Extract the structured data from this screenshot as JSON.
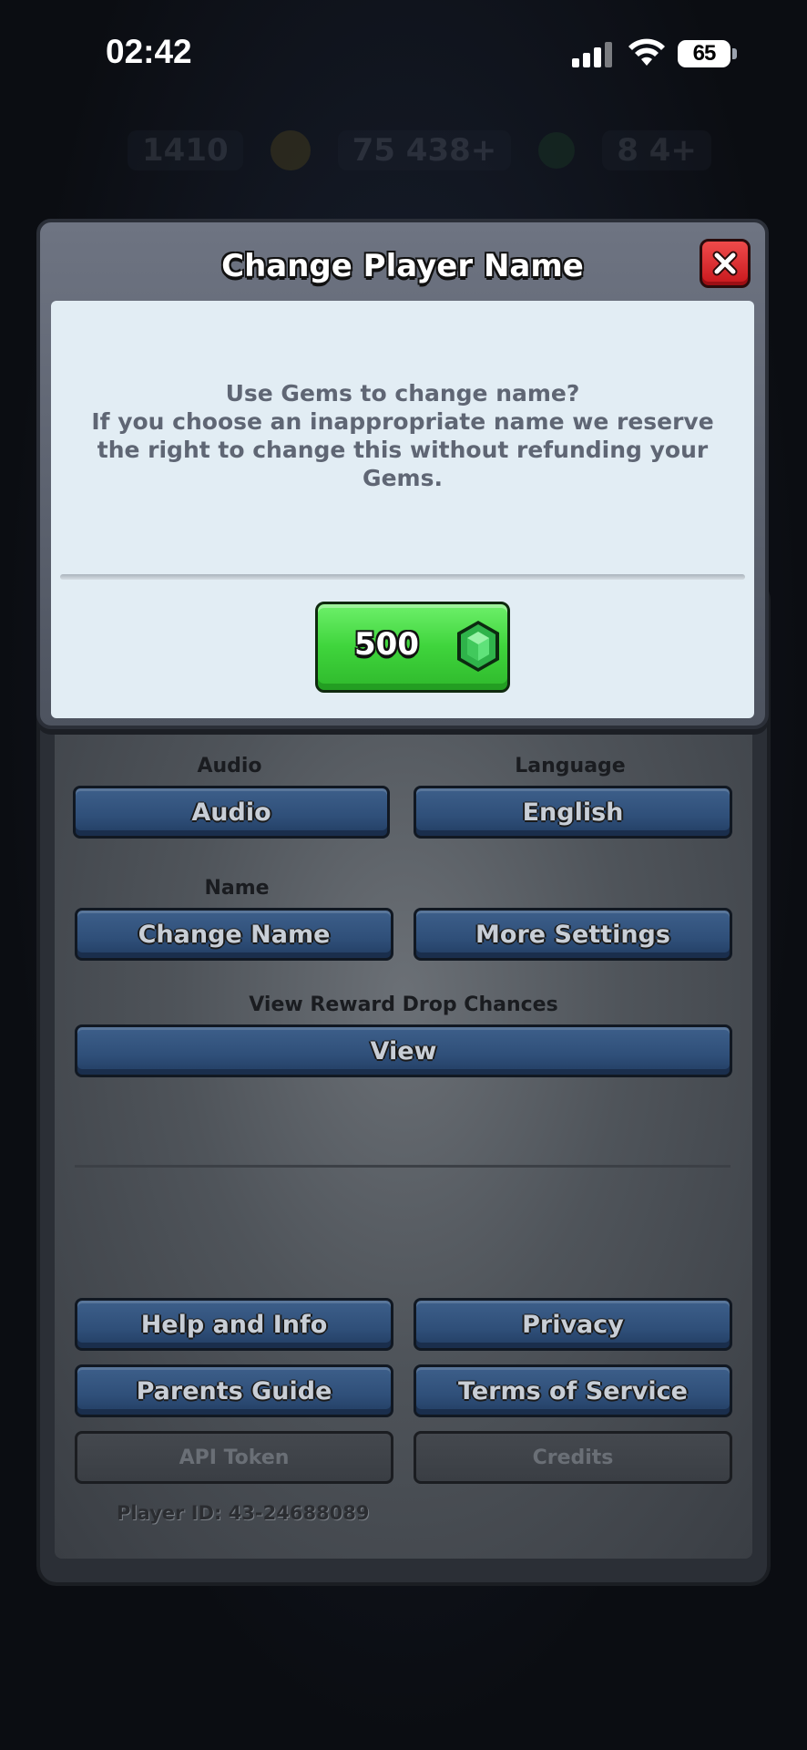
{
  "status_bar": {
    "time": "02:42",
    "battery": "65"
  },
  "background_hud": {
    "trophies": "1410",
    "gold": "75 438+",
    "gems": "8 4+"
  },
  "modal": {
    "title": "Change Player Name",
    "message": "Use Gems to change name?\nIf you choose an inappropriate name we reserve the right to change this without refunding your Gems.",
    "gem_cost": "500",
    "close_icon": "close-icon",
    "gem_icon": "gem-icon"
  },
  "settings": {
    "audio_label": "Audio",
    "audio_button": "Audio",
    "language_label": "Language",
    "language_button": "English",
    "name_label": "Name",
    "change_name_button": "Change Name",
    "more_settings_button": "More Settings",
    "reward_label": "View Reward Drop Chances",
    "view_button": "View",
    "help_button": "Help and Info",
    "privacy_button": "Privacy",
    "parents_button": "Parents Guide",
    "terms_button": "Terms of Service",
    "api_token_button": "API Token",
    "credits_button": "Credits",
    "player_id": "Player ID: 43-24688089"
  },
  "colors": {
    "modal_body": "#e2edf4",
    "gem_button": "#3fd43c",
    "close_button": "#e02a2e",
    "settings_button": "#2f4f79"
  }
}
